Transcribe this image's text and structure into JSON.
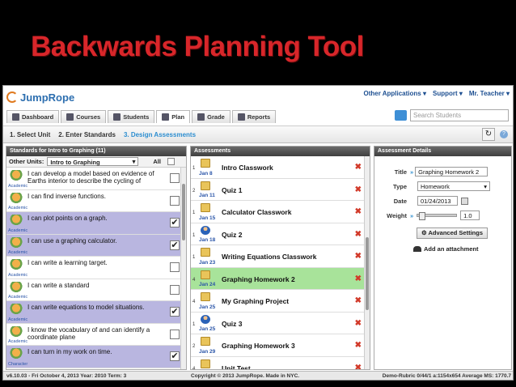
{
  "slide": {
    "title": "Backwards Planning Tool"
  },
  "app": {
    "logo": "JumpRope",
    "topnav": {
      "apps": "Other Applications ▾",
      "support": "Support ▾",
      "user": "Mr. Teacher ▾"
    },
    "tabs": [
      {
        "label": "Dashboard",
        "icon": "home-icon"
      },
      {
        "label": "Courses",
        "icon": "people-icon"
      },
      {
        "label": "Students",
        "icon": "student-icon"
      },
      {
        "label": "Plan",
        "icon": "plan-icon",
        "active": true
      },
      {
        "label": "Grade",
        "icon": "grid-icon"
      },
      {
        "label": "Reports",
        "icon": "report-icon"
      }
    ],
    "search_placeholder": "Search Students",
    "steps": [
      "1. Select Unit",
      "2. Enter Standards",
      "3. Design Assessments"
    ],
    "standards": {
      "header": "Standards for Intro to Graphing (11)",
      "units_label": "Other Units:",
      "unit_value": "Intro to Graphing",
      "all_label": "All",
      "items": [
        {
          "text": "I can develop a model based on evidence of Earths interior to describe the cycling of",
          "category": "Academic",
          "checked": false
        },
        {
          "text": "I can find inverse functions.",
          "category": "Academic",
          "checked": false
        },
        {
          "text": "I can plot points on a graph.",
          "category": "Academic",
          "checked": true
        },
        {
          "text": "I can use a graphing calculator.",
          "category": "Academic",
          "checked": true
        },
        {
          "text": "I can write a learning target.",
          "category": "Academic",
          "checked": false
        },
        {
          "text": "I can write a standard",
          "category": "Academic",
          "checked": false
        },
        {
          "text": "I can write equations to model situations.",
          "category": "Academic",
          "checked": true
        },
        {
          "text": "I know the vocabulary of and can identify a coordinate plane",
          "category": "Academic",
          "checked": false
        },
        {
          "text": "I can turn in my work on time.",
          "category": "Character",
          "checked": true
        }
      ]
    },
    "assessments": {
      "header": "Assessments",
      "items": [
        {
          "num": "1",
          "date": "Jan 8",
          "name": "Intro Classwork",
          "icon": "worksheet"
        },
        {
          "num": "2",
          "date": "Jan 11",
          "name": "Quiz 1",
          "icon": "worksheet"
        },
        {
          "num": "1",
          "date": "Jan 15",
          "name": "Calculator Classwork",
          "icon": "worksheet"
        },
        {
          "num": "1",
          "date": "Jan 18",
          "name": "Quiz 2",
          "icon": "person"
        },
        {
          "num": "1",
          "date": "Jan 23",
          "name": "Writing Equations Classwork",
          "icon": "worksheet"
        },
        {
          "num": "4",
          "date": "Jan 24",
          "name": "Graphing Homework 2",
          "icon": "worksheet",
          "selected": true
        },
        {
          "num": "4",
          "date": "Jan 25",
          "name": "My Graphing Project",
          "icon": "worksheet"
        },
        {
          "num": "1",
          "date": "Jan 25",
          "name": "Quiz 3",
          "icon": "person"
        },
        {
          "num": "2",
          "date": "Jan 29",
          "name": "Graphing Homework 3",
          "icon": "worksheet"
        },
        {
          "num": "4",
          "date": "",
          "name": "Unit Test",
          "icon": "worksheet"
        }
      ]
    },
    "details": {
      "header": "Assessment Details",
      "title_label": "Title",
      "title_value": "Graphing Homework 2",
      "type_label": "Type",
      "type_value": "Homework",
      "date_label": "Date",
      "date_value": "01/24/2013",
      "weight_label": "Weight",
      "weight_value": "1.0",
      "advanced_label": "Advanced Settings",
      "attach_label": "Add an attachment"
    },
    "footer": {
      "left": "v6.10.03 - Fri October 4, 2013  Year: 2010  Term: 3",
      "center": "Copyright © 2013 JumpRope.    Made in NYC.",
      "right": "Demo-Rubric  0/44/1  a:1154x654  Average MS: 1770.7"
    }
  }
}
